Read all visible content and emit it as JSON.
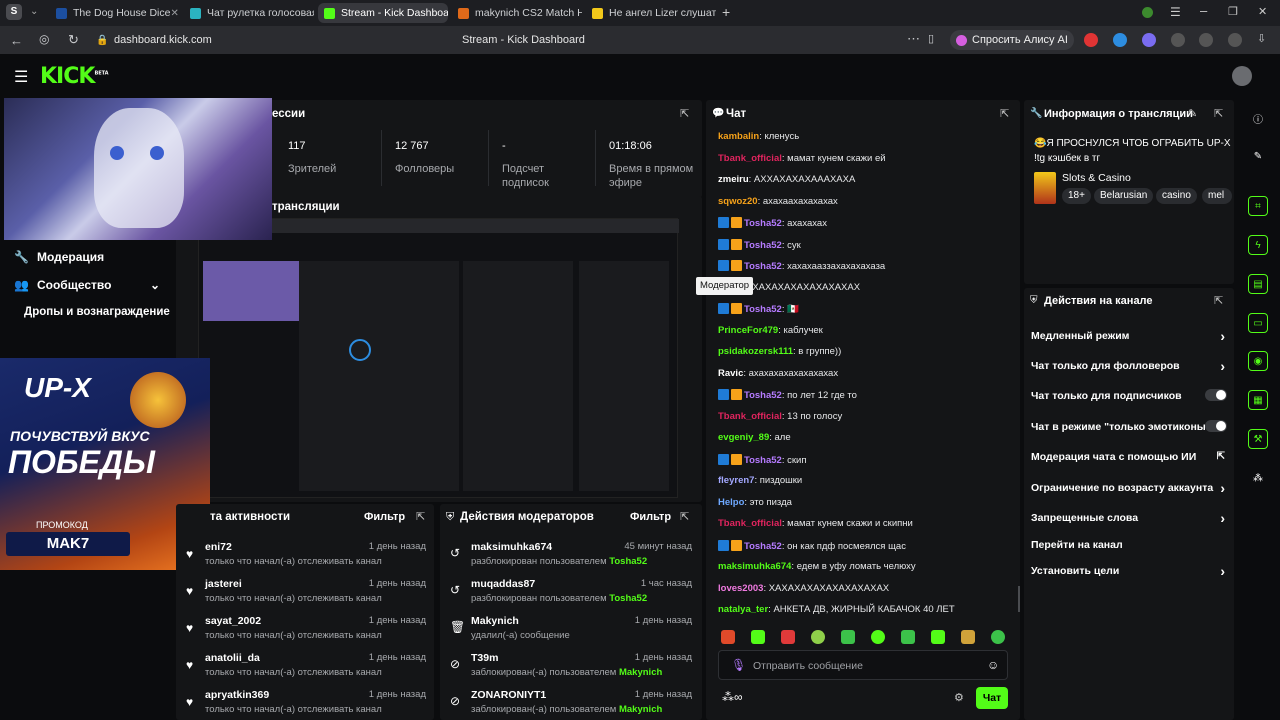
{
  "browser": {
    "tabs": [
      {
        "label": "The Dog House Dice",
        "active": false
      },
      {
        "label": "Чат рулетка голосовая —",
        "active": false
      },
      {
        "label": "Stream - Kick Dashboar",
        "active": true
      },
      {
        "label": "makynich CS2 Match Hist",
        "active": false
      },
      {
        "label": "Не ангел Lizer слушать о",
        "active": false
      }
    ],
    "url": "dashboard.kick.com",
    "page_title": "Stream - Kick Dashboard",
    "alice_label": "Спросить Алису AI"
  },
  "site": {
    "logo": "KICK",
    "logo_sup": "BETA"
  },
  "overlay": {
    "promo_brand": "UP-X",
    "promo_slogan_1": "ПОЧУВСТВУЙ ВКУС",
    "promo_slogan_2": "ПОБЕДЫ",
    "promo_label": "ПРОМОКОД",
    "promo_code": "MAK7"
  },
  "session": {
    "title": "ессии",
    "stats": [
      {
        "value": "117",
        "label": "Зрителей"
      },
      {
        "value": "12 767",
        "label": "Фолловеры"
      },
      {
        "value": "-",
        "label": "Подсчет подписок"
      },
      {
        "value": "01:18:06",
        "label": "Время в прямом эфире"
      }
    ],
    "preview_title": "трансляции"
  },
  "sidebar": {
    "items": [
      {
        "label": "Модерация"
      },
      {
        "label": "Сообщество"
      },
      {
        "label": "Дропы и вознаграждение"
      }
    ]
  },
  "activity": {
    "title": "та активности",
    "filter": "Фильтр",
    "items": [
      {
        "name": "eni72",
        "text": "только что начал(-а) отслеживать канал",
        "time": "1 день назад"
      },
      {
        "name": "jasterei",
        "text": "только что начал(-а) отслеживать канал",
        "time": "1 день назад"
      },
      {
        "name": "sayat_2002",
        "text": "только что начал(-а) отслеживать канал",
        "time": "1 день назад"
      },
      {
        "name": "anatolii_da",
        "text": "только что начал(-а) отслеживать канал",
        "time": "1 день назад"
      },
      {
        "name": "apryatkin369",
        "text": "только что начал(-а) отслеживать канал",
        "time": "1 день назад"
      }
    ]
  },
  "modactions": {
    "title": "Действия модераторов",
    "filter": "Фильтр",
    "items": [
      {
        "name": "maksimuhka674",
        "text": "разблокирован пользователем",
        "who": "Tosha52",
        "time": "45 минут назад"
      },
      {
        "name": "muqaddas87",
        "text": "разблокирован пользователем",
        "who": "Tosha52",
        "time": "1 час назад"
      },
      {
        "name": "Makynich",
        "text": "удалил(-а) сообщение",
        "who": "",
        "time": "1 день назад"
      },
      {
        "name": "T39m",
        "text": "заблокирован(-а) пользователем",
        "who": "Makynich",
        "time": "1 день назад"
      },
      {
        "name": "ZONARONIYT1",
        "text": "заблокирован(-а) пользователем",
        "who": "Makynich",
        "time": "1 день назад"
      }
    ]
  },
  "chat": {
    "title": "Чат",
    "tooltip": "Модератор",
    "input_placeholder": "Отправить сообщение",
    "send_label": "Чат",
    "messages": [
      {
        "user": "kambalin",
        "color": "#f6a21a",
        "badges": false,
        "text": "кленусь"
      },
      {
        "user": "Tbank_official",
        "color": "#e0245e",
        "badges": false,
        "text": "мамат кунем скажи ей"
      },
      {
        "user": "zmeiru",
        "color": "#ffffff",
        "badges": false,
        "text": "АХХАХАХАХАААХАХА"
      },
      {
        "user": "sqwoz20",
        "color": "#f6a21a",
        "badges": false,
        "text": "ахахаахахахахах"
      },
      {
        "user": "Tosha52",
        "color": "#b57bff",
        "badges": true,
        "text": "ахахахах"
      },
      {
        "user": "Tosha52",
        "color": "#b57bff",
        "badges": true,
        "text": "сук"
      },
      {
        "user": "Tosha52",
        "color": "#b57bff",
        "badges": true,
        "text": "хахахааззахахахахаза"
      },
      {
        "user": "h79",
        "color": "#b57bff",
        "badges": false,
        "text": "ХАХАХАХАХАХАХАХАХАХ"
      },
      {
        "user": "Tosha52",
        "color": "#b57bff",
        "badges": true,
        "text": "🇲🇽"
      },
      {
        "user": "PrinceFor479",
        "color": "#53fc18",
        "badges": false,
        "text": "каблучек"
      },
      {
        "user": "psidakozersk111",
        "color": "#53fc18",
        "badges": false,
        "text": "в группе))"
      },
      {
        "user": "Ravic",
        "color": "#ffffff",
        "badges": false,
        "text": "ахахахахахахахахах"
      },
      {
        "user": "Tosha52",
        "color": "#b57bff",
        "badges": true,
        "text": "по лет 12 где то"
      },
      {
        "user": "Tbank_official",
        "color": "#e0245e",
        "badges": false,
        "text": "13 по голосу"
      },
      {
        "user": "evgeniy_89",
        "color": "#53fc18",
        "badges": false,
        "text": "але"
      },
      {
        "user": "Tosha52",
        "color": "#b57bff",
        "badges": true,
        "text": "скип"
      },
      {
        "user": "fleyren7",
        "color": "#a3a8ff",
        "badges": false,
        "text": "пиздошки"
      },
      {
        "user": "Helpo",
        "color": "#6ea8ff",
        "badges": false,
        "text": "это пизда"
      },
      {
        "user": "Tbank_official",
        "color": "#e0245e",
        "badges": false,
        "text": "мамат кунем скажи и скипни"
      },
      {
        "user": "Tosha52",
        "color": "#b57bff",
        "badges": true,
        "text": "он как пдф посмеялся щас"
      },
      {
        "user": "maksimuhka674",
        "color": "#53fc18",
        "badges": false,
        "text": "едем в уфу ломать челюху"
      },
      {
        "user": "loves2003",
        "color": "#f07ae0",
        "badges": false,
        "text": "ХАХАХАХАХАХАХАХАХАХ"
      },
      {
        "user": "natalya_ter",
        "color": "#53fc18",
        "badges": false,
        "text": "АНКЕТА ДВ, ЖИРНЫЙ КАБАЧОК 40 ЛЕТ"
      }
    ]
  },
  "streaminfo": {
    "title": "Информация о трансляции",
    "stream_title_1": "😂Я ПРОСНУЛСЯ ЧТОБ ОГРАБИТЬ UP-X",
    "stream_title_2": "!tg кэшбек в тг",
    "category": "Slots & Casino",
    "tags": [
      "18+",
      "Belarusian",
      "casino",
      "mel"
    ]
  },
  "channelactions": {
    "title": "Действия на канале",
    "rows": [
      {
        "label": "Медленный режим",
        "kind": "chevron"
      },
      {
        "label": "Чат только для фолловеров",
        "kind": "chevron"
      },
      {
        "label": "Чат только для подписчиков",
        "kind": "toggle"
      },
      {
        "label": "Чат в режиме \"только эмотиконы\"",
        "kind": "toggle"
      },
      {
        "label": "Модерация чата с помощью ИИ",
        "kind": "external"
      },
      {
        "label": "Ограничение по возрасту аккаунта",
        "kind": "chevron"
      },
      {
        "label": "Запрещенные слова",
        "kind": "chevron"
      },
      {
        "label": "Перейти на канал",
        "kind": "none"
      },
      {
        "label": "Установить цели",
        "kind": "chevron"
      }
    ]
  },
  "colors": {
    "accent": "#53fc18",
    "panel": "#141517",
    "bg": "#0b0c0e"
  }
}
